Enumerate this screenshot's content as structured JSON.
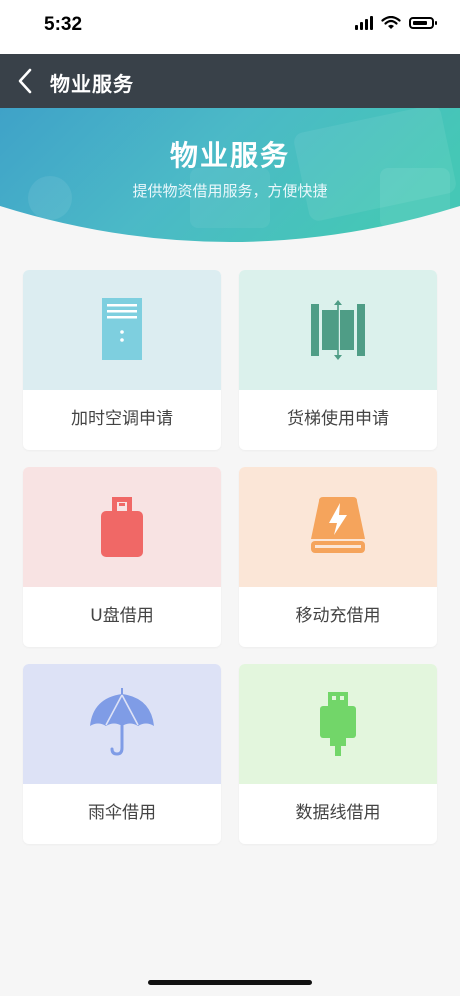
{
  "status": {
    "time": "5:32"
  },
  "nav": {
    "title": "物业服务"
  },
  "banner": {
    "title": "物业服务",
    "subtitle": "提供物资借用服务，方便快捷"
  },
  "services": [
    {
      "label": "加时空调申请",
      "icon": "air-conditioner-icon",
      "bg": "#dcedf1",
      "color": "#7ecfdf"
    },
    {
      "label": "货梯使用申请",
      "icon": "elevator-icon",
      "bg": "#dbf1ec",
      "color": "#4f9d86"
    },
    {
      "label": "U盘借用",
      "icon": "usb-drive-icon",
      "bg": "#f8e3e3",
      "color": "#f06866"
    },
    {
      "label": "移动充借用",
      "icon": "power-bank-icon",
      "bg": "#fbe6d7",
      "color": "#f5a45c"
    },
    {
      "label": "雨伞借用",
      "icon": "umbrella-icon",
      "bg": "#dde2f6",
      "color": "#7f9ce6"
    },
    {
      "label": "数据线借用",
      "icon": "data-cable-icon",
      "bg": "#e3f6dd",
      "color": "#72d669"
    }
  ]
}
